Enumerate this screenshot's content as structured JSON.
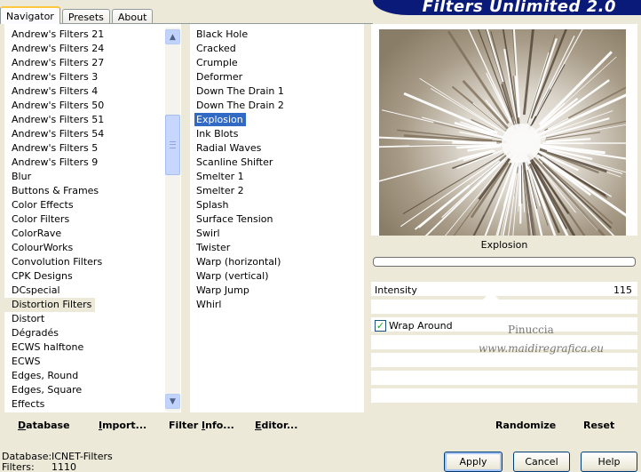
{
  "tabs": [
    {
      "label": "Navigator",
      "active": true
    },
    {
      "label": "Presets",
      "active": false
    },
    {
      "label": "About",
      "active": false
    }
  ],
  "banner_title": "Filters Unlimited 2.0",
  "categories": [
    "Andrew's Filters 21",
    "Andrew's Filters 24",
    "Andrew's Filters 27",
    "Andrew's Filters 3",
    "Andrew's Filters 4",
    "Andrew's Filters 50",
    "Andrew's Filters 51",
    "Andrew's Filters 54",
    "Andrew's Filters 5",
    "Andrew's Filters 9",
    "Blur",
    "Buttons & Frames",
    "Color Effects",
    "Color Filters",
    "ColorRave",
    "ColourWorks",
    "Convolution Filters",
    "CPK Designs",
    "DCspecial",
    "Distortion Filters",
    "Distort",
    "Dégradés",
    "ECWS halftone",
    "ECWS",
    "Edges, Round",
    "Edges, Square",
    "Effects"
  ],
  "selected_category": "Distortion Filters",
  "filters": [
    "Black Hole",
    "Cracked",
    "Crumple",
    "Deformer",
    "Down The Drain 1",
    "Down The Drain 2",
    "Explosion",
    "Ink Blots",
    "Radial Waves",
    "Scanline Shifter",
    "Smelter 1",
    "Smelter 2",
    "Splash",
    "Surface Tension",
    "Swirl",
    "Twister",
    "Warp (horizontal)",
    "Warp (vertical)",
    "Warp Jump",
    "Whirl"
  ],
  "selected_filter": "Explosion",
  "preview": {
    "filter_name": "Explosion",
    "progress": 0
  },
  "params": {
    "intensity_label": "Intensity",
    "intensity_value": "115",
    "wrap_label": "Wrap Around",
    "wrap_checked": true,
    "watermark_line1": "Pinuccia",
    "watermark_line2": "www.maidiregrafica.eu"
  },
  "toolbar": {
    "database": {
      "u": "D",
      "rest": "atabase"
    },
    "import": {
      "u": "I",
      "rest": "mport..."
    },
    "filter_info": {
      "pre": "Filter ",
      "u": "I",
      "rest": "nfo..."
    },
    "editor": {
      "u": "E",
      "rest": "ditor..."
    },
    "randomize": "Randomize",
    "reset": "Reset"
  },
  "status": {
    "database_label": "Database:",
    "database_value": "ICNET-Filters",
    "filters_label": "Filters:",
    "filters_value": "1110"
  },
  "buttons": {
    "apply": "Apply",
    "cancel": "Cancel",
    "help": "Help"
  },
  "icons": {
    "scroll_up": "arrow-up-icon",
    "scroll_down": "arrow-down-icon",
    "check": "checkmark-icon"
  }
}
